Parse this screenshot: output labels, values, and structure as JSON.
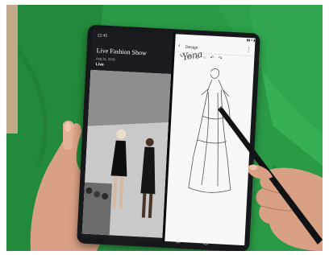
{
  "video_panel": {
    "status_time": "12:45",
    "title": "Live Fashion Show",
    "date": "Aug 21, 2020",
    "live_label": "Live"
  },
  "notes_panel": {
    "app_name": "Design",
    "handwriting": "Yona"
  },
  "colors": {
    "background": "#2a9a45",
    "phone_body": "#16181c",
    "skin": "#d9a184"
  },
  "icons": {
    "back": "back-arrow-icon",
    "menu": "more-icon",
    "nav_recent": "recent-apps-icon",
    "nav_home": "home-icon",
    "nav_back": "back-icon"
  }
}
